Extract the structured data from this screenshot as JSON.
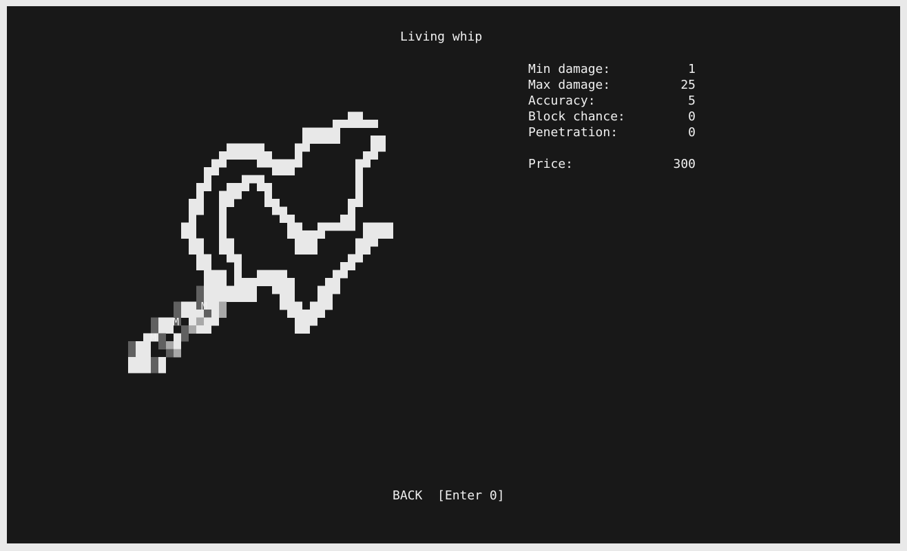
{
  "item": {
    "name": "Living whip",
    "stats": [
      {
        "label": "Min damage:",
        "value": "1"
      },
      {
        "label": "Max damage:",
        "value": "25"
      },
      {
        "label": "Accuracy:",
        "value": "5"
      },
      {
        "label": "Block chance:",
        "value": "0"
      },
      {
        "label": "Penetration:",
        "value": "0"
      }
    ],
    "price": {
      "label": "Price:",
      "value": "300"
    }
  },
  "art": {
    "glyph": "M",
    "colors": {
      "background": "#181818",
      "light": "#e8e8e8",
      "mid": "#a8a8a8",
      "dark": "#606060"
    }
  },
  "footer": {
    "back_label": "BACK",
    "back_hint": "[Enter 0]"
  }
}
